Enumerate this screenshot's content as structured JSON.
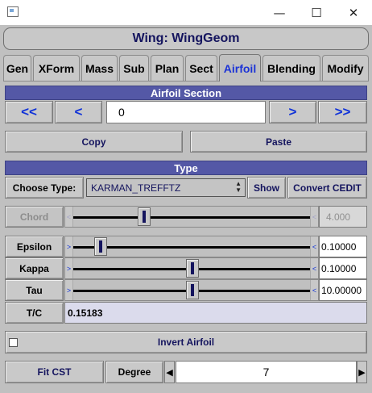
{
  "window": {
    "minimize_glyph": "—",
    "maximize_glyph": "☐",
    "close_glyph": "✕"
  },
  "header": {
    "title": "Wing: WingGeom"
  },
  "tabs": [
    {
      "label": "Gen"
    },
    {
      "label": "XForm"
    },
    {
      "label": "Mass"
    },
    {
      "label": "Sub"
    },
    {
      "label": "Plan"
    },
    {
      "label": "Sect"
    },
    {
      "label": "Airfoil",
      "active": true
    },
    {
      "label": "Blending"
    },
    {
      "label": "Modify"
    }
  ],
  "airfoil_section": {
    "title": "Airfoil Section",
    "first_label": "<<",
    "prev_label": "<",
    "index_value": "0",
    "next_label": ">",
    "last_label": ">>",
    "copy_label": "Copy",
    "paste_label": "Paste"
  },
  "type_section": {
    "title": "Type",
    "choose_type_label": "Choose Type:",
    "selected_type": "KARMAN_TREFFTZ",
    "show_label": "Show",
    "convert_label": "Convert CEDIT"
  },
  "params": {
    "chord": {
      "label": "Chord",
      "value": "4.000",
      "level": 0.29
    },
    "epsilon": {
      "label": "Epsilon",
      "value": "0.10000",
      "level": 0.12
    },
    "kappa": {
      "label": "Kappa",
      "value": "0.10000",
      "level": 0.5
    },
    "tau": {
      "label": "Tau",
      "value": "10.00000",
      "level": 0.5
    },
    "tc": {
      "label": "T/C",
      "value": "0.15183"
    }
  },
  "invert": {
    "label": "Invert Airfoil",
    "checked": false
  },
  "fit": {
    "fit_cst_label": "Fit CST",
    "degree_label": "Degree",
    "degree_value": "7"
  },
  "arrows": {
    "left": "<",
    "right": ">",
    "left_small": "◀",
    "right_small": "▶"
  }
}
